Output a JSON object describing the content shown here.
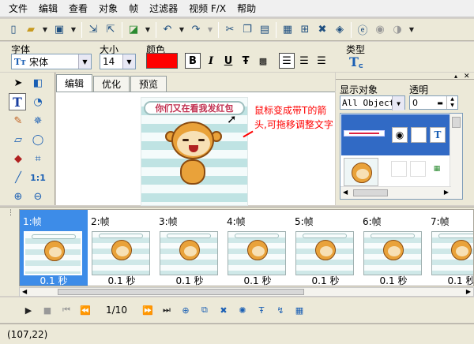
{
  "menu": [
    "文件",
    "编辑",
    "查看",
    "对象",
    "帧",
    "过滤器",
    "视频 F/X",
    "帮助"
  ],
  "props": {
    "font_label": "字体",
    "font_value": "宋体",
    "size_label": "大小",
    "size_value": "14",
    "color_label": "颜色",
    "text_color": "#ff0000",
    "bold": "B",
    "italic": "I",
    "underline": "U",
    "type_label": "类型"
  },
  "editor": {
    "tabs": [
      "编辑",
      "优化",
      "预览"
    ],
    "banner_text": "你们又在看我发红包",
    "annotation": "鼠标变成带T的箭头,可拖移调整文字"
  },
  "right": {
    "object_label": "显示对象",
    "object_value": "All Object",
    "transparency_label": "透明",
    "transparency_value": "0"
  },
  "frames": [
    {
      "label": "1:帧",
      "duration": "0.1 秒"
    },
    {
      "label": "2:帧",
      "duration": "0.1 秒"
    },
    {
      "label": "3:帧",
      "duration": "0.1 秒"
    },
    {
      "label": "4:帧",
      "duration": "0.1 秒"
    },
    {
      "label": "5:帧",
      "duration": "0.1 秒"
    },
    {
      "label": "6:帧",
      "duration": "0.1 秒"
    },
    {
      "label": "7:帧",
      "duration": "0.1 秒"
    }
  ],
  "playback": {
    "counter": "1/10"
  },
  "status": {
    "coords": "(107,22)"
  }
}
